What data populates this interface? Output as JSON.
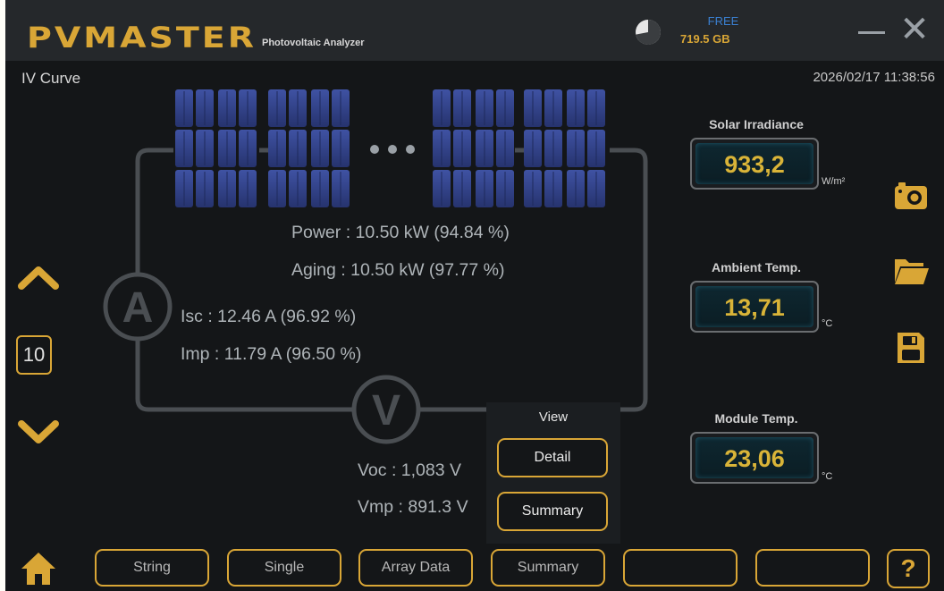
{
  "titlebar": {
    "logo": "PVMASTER",
    "logo_subtitle": "Photovoltaic Analyzer",
    "storage_label": "FREE",
    "storage_value": "719.5 GB",
    "storage_used_fraction": 0.72
  },
  "page": {
    "title": "IV Curve",
    "datetime": "2026/02/17 11:38:56"
  },
  "diagram": {
    "ammeter_symbol": "A",
    "voltmeter_symbol": "V"
  },
  "readouts": {
    "power": "Power : 10.50 kW (94.84 %)",
    "aging": "Aging : 10.50 kW (97.77 %)",
    "isc": "Isc : 12.46 A (96.92 %)",
    "imp": "Imp : 11.79 A (96.50 %)",
    "voc": "Voc : 1,083 V",
    "vmp": "Vmp : 891.3 V"
  },
  "navigation": {
    "page_number": "10"
  },
  "sensors": {
    "irradiance": {
      "label": "Solar Irradiance",
      "value": "933,2",
      "unit": "W/m²"
    },
    "ambient": {
      "label": "Ambient Temp.",
      "value": "13,71",
      "unit": "°C"
    },
    "module": {
      "label": "Module Temp.",
      "value": "23,06",
      "unit": "°C"
    }
  },
  "view_menu": {
    "title": "View",
    "options": [
      "Detail",
      "Summary"
    ]
  },
  "bottom_bar": {
    "buttons": [
      "String",
      "Single",
      "Array Data",
      "Summary",
      "",
      ""
    ],
    "help": "?"
  },
  "colors": {
    "accent": "#d9a636",
    "background": "#141618",
    "panel_blue": "#2f3f86",
    "readout_text": "#aeb4b8"
  },
  "icons": {
    "camera": "camera-icon",
    "folder": "folder-icon",
    "save": "save-icon",
    "home": "home-icon",
    "up": "chevron-up-icon",
    "down": "chevron-down-icon"
  }
}
